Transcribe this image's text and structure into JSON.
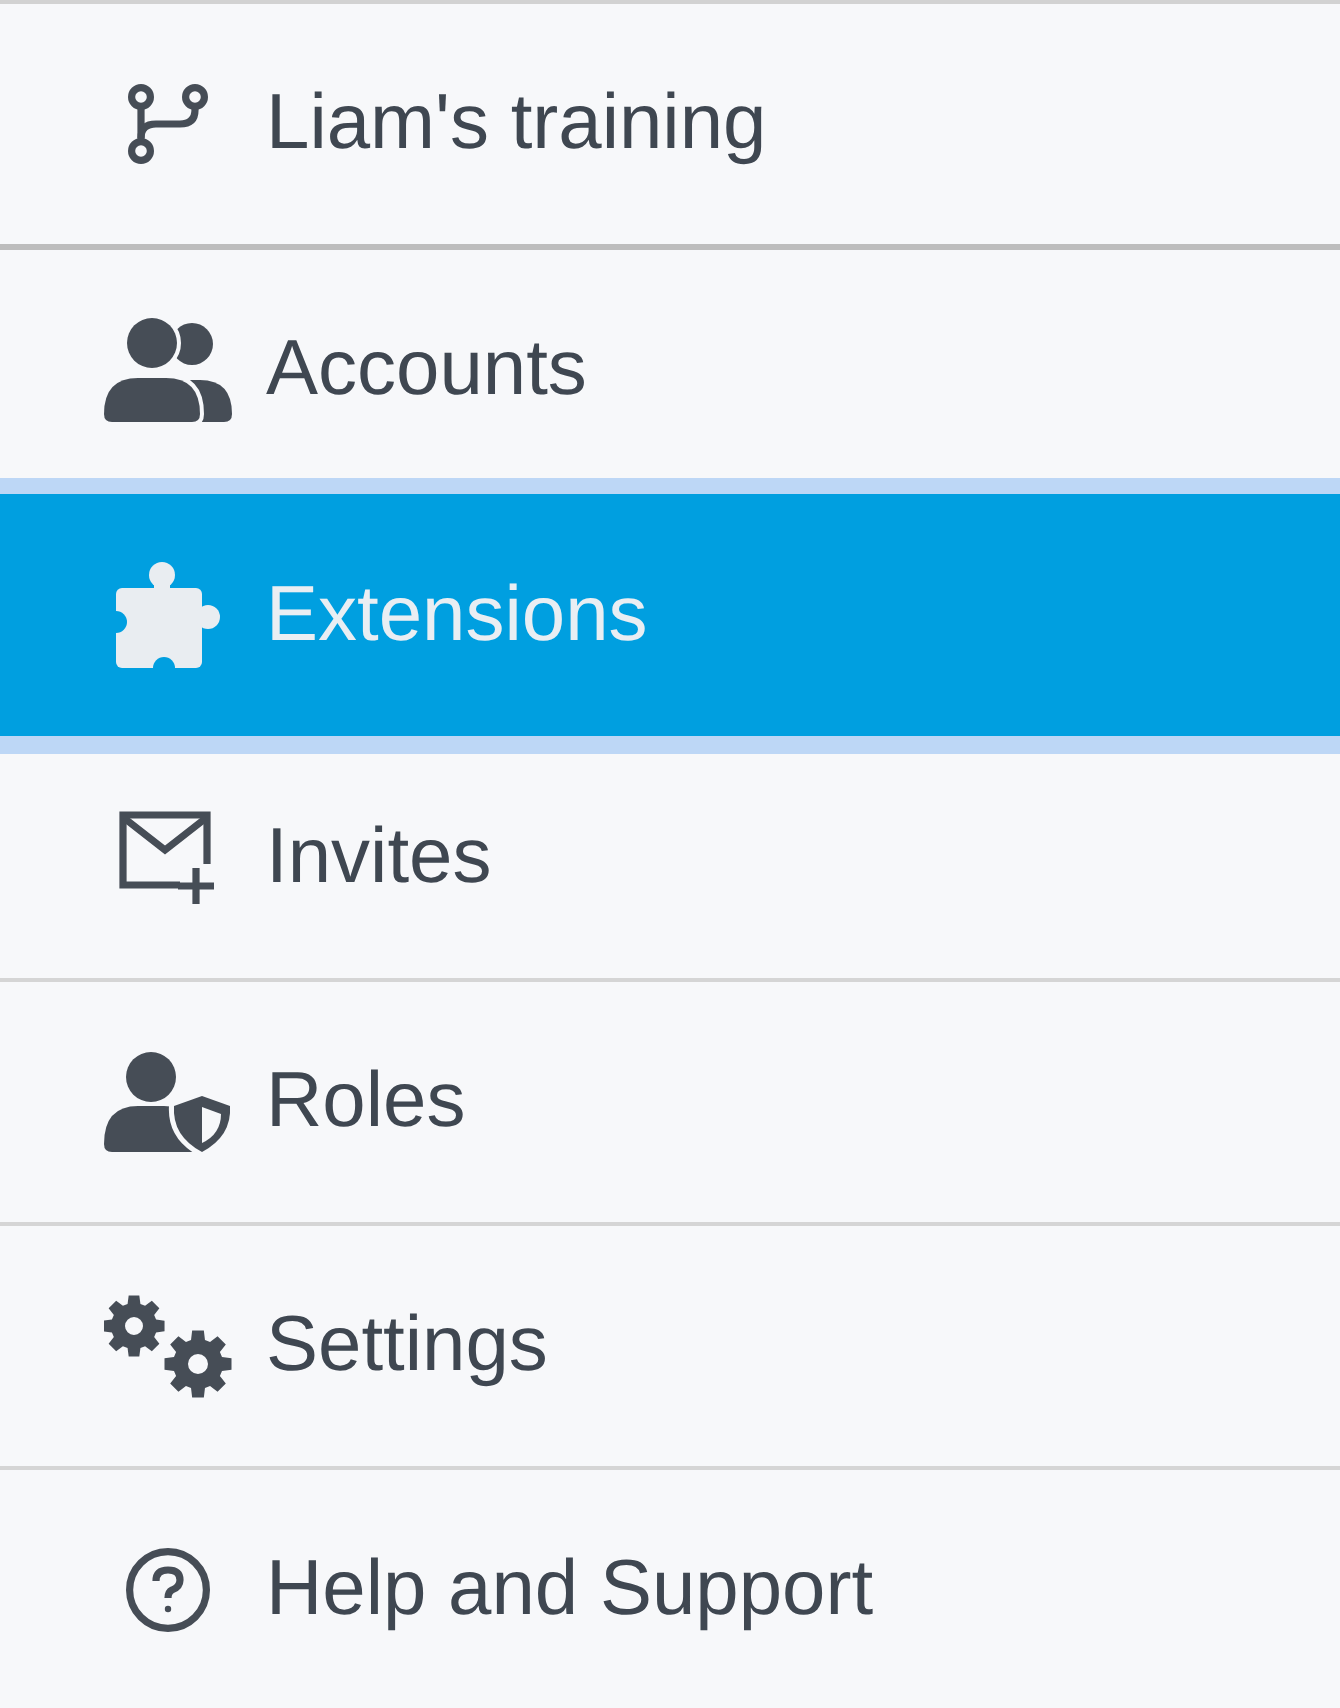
{
  "workspace": {
    "label": "Liam's training"
  },
  "menu": {
    "items": [
      {
        "label": "Accounts",
        "selected": false
      },
      {
        "label": "Extensions",
        "selected": true
      },
      {
        "label": "Invites",
        "selected": false
      },
      {
        "label": "Roles",
        "selected": false
      },
      {
        "label": "Settings",
        "selected": false
      },
      {
        "label": "Help and Support",
        "selected": false
      }
    ]
  }
}
